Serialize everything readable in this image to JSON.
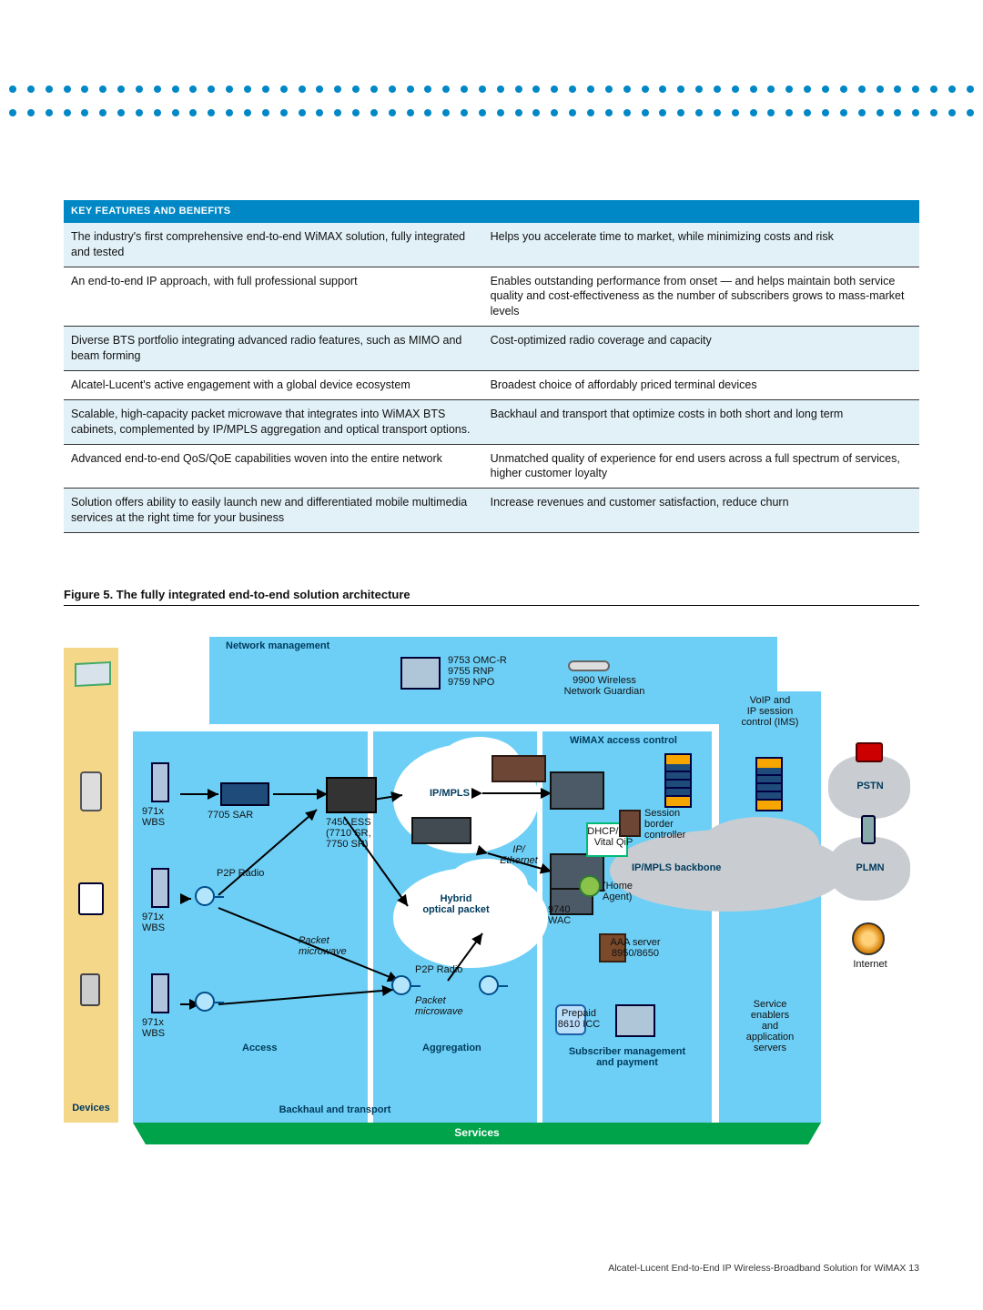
{
  "table": {
    "header": "KEY FEATURES AND BENEFITS",
    "rows": [
      {
        "l": "The industry's first comprehensive end-to-end WiMAX solution, fully integrated and tested",
        "r": "Helps you accelerate time to market, while minimizing costs and risk"
      },
      {
        "l": "An end-to-end IP approach, with full professional support",
        "r": "Enables outstanding performance from onset — and helps maintain both service quality and cost-effectiveness as the number of subscribers grows to mass-market levels"
      },
      {
        "l": "Diverse BTS portfolio integrating advanced radio features, such as MIMO and beam forming",
        "r": "Cost-optimized radio coverage and capacity"
      },
      {
        "l": "Alcatel-Lucent's active engagement with a global device ecosystem",
        "r": "Broadest choice of affordably priced terminal devices"
      },
      {
        "l": "Scalable, high-capacity packet microwave that integrates into WiMAX BTS cabinets, complemented by IP/MPLS aggregation and optical transport options.",
        "r": "Backhaul and transport that optimize costs in both short and long term"
      },
      {
        "l": "Advanced end-to-end QoS/QoE capabilities woven into the entire network",
        "r": "Unmatched quality of experience for end users across a full spectrum of services, higher customer loyalty"
      },
      {
        "l": "Solution offers ability to easily launch new and differentiated mobile multimedia services at the right time for your business",
        "r": "Increase revenues and customer satisfaction, reduce churn"
      }
    ]
  },
  "figure_caption": "Figure 5. The fully integrated end-to-end solution architecture",
  "labels": {
    "network_management": "Network management",
    "omc_lines": "9753 OMC-R\n9755 RNP\n9759 NPO",
    "wng": "9900 Wireless\nNetwork Guardian",
    "ims": "VoIP and\nIP session\ncontrol (IMS)",
    "wimax_ac": "WiMAX access control",
    "ipmpls": "IP/MPLS",
    "ip_eth": "IP/\nEthernet",
    "hybrid": "Hybrid\noptical packet",
    "wbs": "971x\nWBS",
    "sar": "7705 SAR",
    "ess": "7450 ESS\n(7710 SR,\n7750 SR)",
    "p2p": "P2P Radio",
    "packet_mw": "Packet\nmicrowave",
    "access": "Access",
    "aggregation": "Aggregation",
    "backhaul": "Backhaul and transport",
    "devices": "Devices",
    "dhcp": "DHCP/DNS\nVital QiP",
    "sbc": "Session\nborder\ncontroller",
    "backbone": "IP/MPLS backbone",
    "wac": "9740\nWAC",
    "home_agent": "(Home\nAgent)",
    "aaa": "AAA server\n8950/8650",
    "prepaid": "Prepaid\n8610 ICC",
    "sub_mgmt": "Subscriber management\nand payment",
    "service_enablers": "Service\nenablers\nand\napplication\nservers",
    "services": "Services",
    "pstn": "PSTN",
    "plmn": "PLMN",
    "internet": "Internet"
  },
  "footer": "Alcatel-Lucent End-to-End IP Wireless-Broadband Solution for WiMAX   13"
}
